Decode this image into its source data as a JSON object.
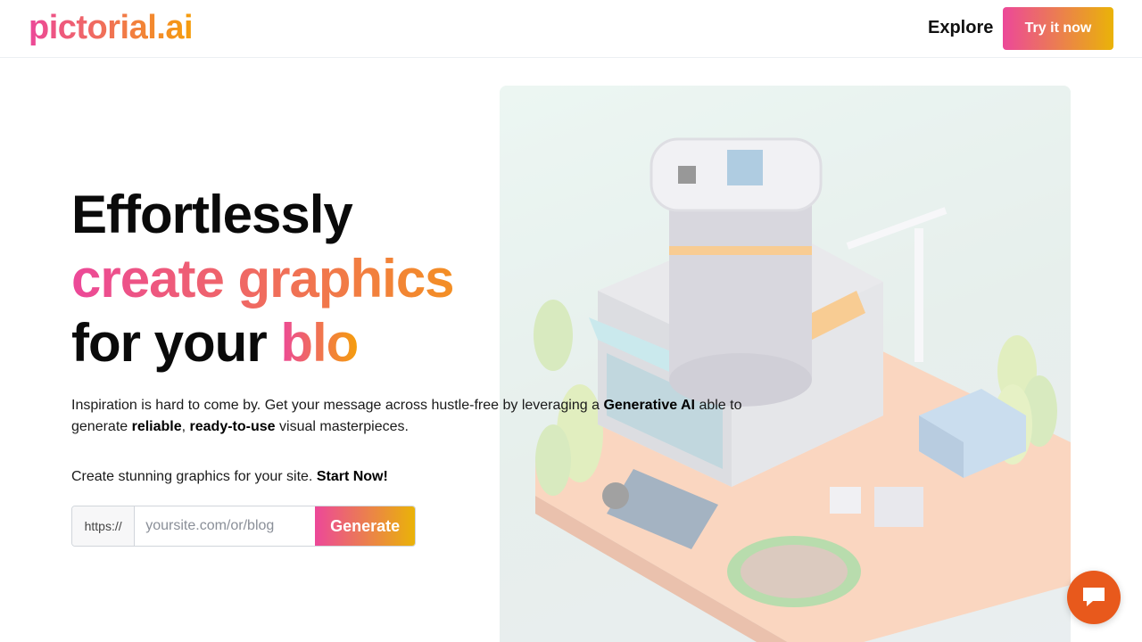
{
  "brand": {
    "logo_text": "pictorial.ai"
  },
  "nav": {
    "explore_label": "Explore",
    "try_label": "Try it now"
  },
  "hero": {
    "headline_line1": "Effortlessly",
    "headline_line2": "create graphics",
    "headline_line3_prefix": "for your ",
    "headline_line3_highlight": "blo",
    "intro_text_1": "Inspiration is hard to come by. Get your message across hustle-free by leveraging a ",
    "intro_bold_1": "Generative AI",
    "intro_text_2": " able to generate ",
    "intro_bold_2": "reliable",
    "intro_text_3": ", ",
    "intro_bold_3": "ready-to-use",
    "intro_text_4": " visual masterpieces.",
    "cta_text": "Create stunning graphics for your site. ",
    "cta_bold": "Start Now!"
  },
  "form": {
    "prefix": "https://",
    "placeholder": "yoursite.com/or/blog",
    "value": "",
    "generate_label": "Generate"
  },
  "colors": {
    "gradient_start": "#ec4899",
    "gradient_end": "#eab308",
    "chat_bubble": "#e8591c"
  },
  "icons": {
    "chat": "chat-bubble-icon",
    "hero_image": "isometric-building-illustration"
  }
}
